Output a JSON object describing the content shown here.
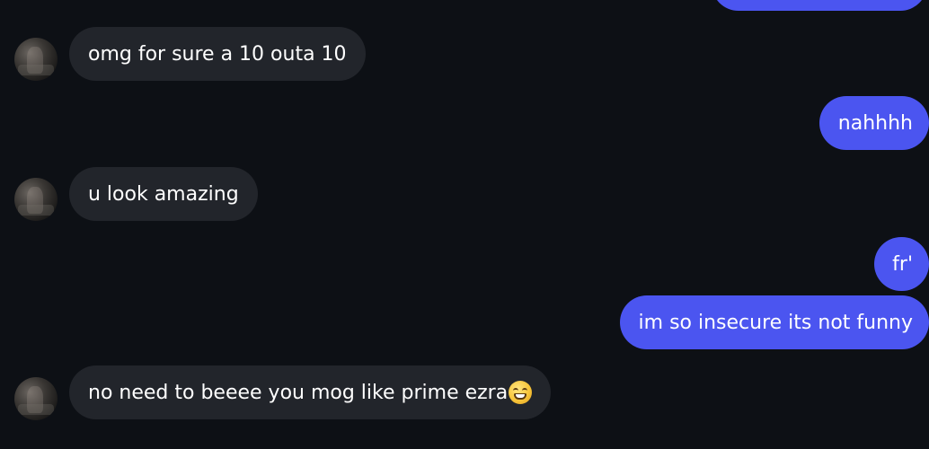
{
  "conversation": {
    "messages": [
      {
        "direction": "outgoing",
        "text": "",
        "partial": true
      },
      {
        "direction": "incoming",
        "text": "omg for sure a 10 outa 10"
      },
      {
        "direction": "outgoing",
        "text": "nahhhh"
      },
      {
        "direction": "incoming",
        "text": "u look amazing"
      },
      {
        "direction": "outgoing",
        "text": "fr'"
      },
      {
        "direction": "outgoing",
        "text": "im so insecure its not funny"
      },
      {
        "direction": "incoming",
        "text": "no need to beeee you mog like prime ezra",
        "emoji": "grinning-face-with-smiling-eyes"
      }
    ]
  },
  "colors": {
    "background": "#0d1015",
    "incoming_bubble": "#22252b",
    "outgoing_bubble": "#4b55f0",
    "text": "#ffffff"
  }
}
